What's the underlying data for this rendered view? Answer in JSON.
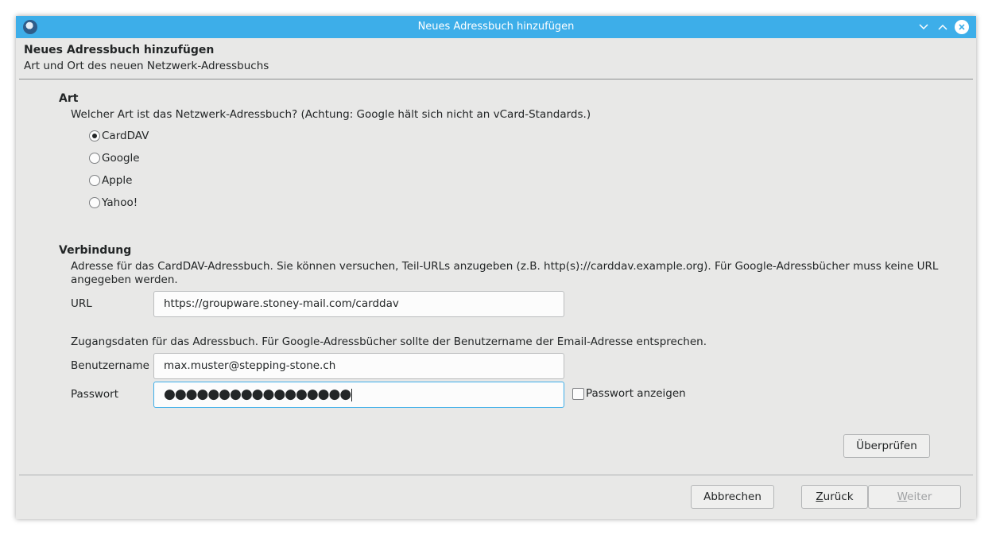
{
  "window": {
    "title": "Neues Adressbuch hinzufügen"
  },
  "header": {
    "title": "Neues Adressbuch hinzufügen",
    "subtitle": "Art und Ort des neuen Netzwerk-Adressbuchs"
  },
  "art": {
    "title": "Art",
    "description": "Welcher Art ist das Netzwerk-Adressbuch? (Achtung: Google hält sich nicht an vCard-Standards.)",
    "options": [
      {
        "label": "CardDAV",
        "selected": true
      },
      {
        "label": "Google",
        "selected": false
      },
      {
        "label": "Apple",
        "selected": false
      },
      {
        "label": "Yahoo!",
        "selected": false
      }
    ]
  },
  "verbindung": {
    "title": "Verbindung",
    "description_line1": "Adresse für das CardDAV-Adressbuch. Sie können versuchen, Teil-URLs anzugeben (z.B. http(s)://carddav.example.org). Für Google-Adressbücher muss keine URL",
    "description_line2": "angegeben werden.",
    "url_label": "URL",
    "url_value": "https://groupware.stoney-mail.com/carddav",
    "credentials_description": "Zugangsdaten für das Adressbuch. Für Google-Adressbücher sollte der Benutzername der Email-Adresse entsprechen.",
    "username_label": "Benutzername",
    "username_value": "max.muster@stepping-stone.ch",
    "password_label": "Passwort",
    "password_masked": "●●●●●●●●●●●●●●●●●",
    "show_password_label": "Passwort anzeigen",
    "show_password_checked": false
  },
  "buttons": {
    "check": "Überprüfen",
    "cancel": "Abbrechen",
    "back_mnemonic": "Z",
    "back_rest": "urück",
    "next_mnemonic": "W",
    "next_rest": "eiter"
  },
  "colors": {
    "titlebar": "#3daee9",
    "window_bg": "#e8e8e7",
    "focus": "#3daee9"
  }
}
